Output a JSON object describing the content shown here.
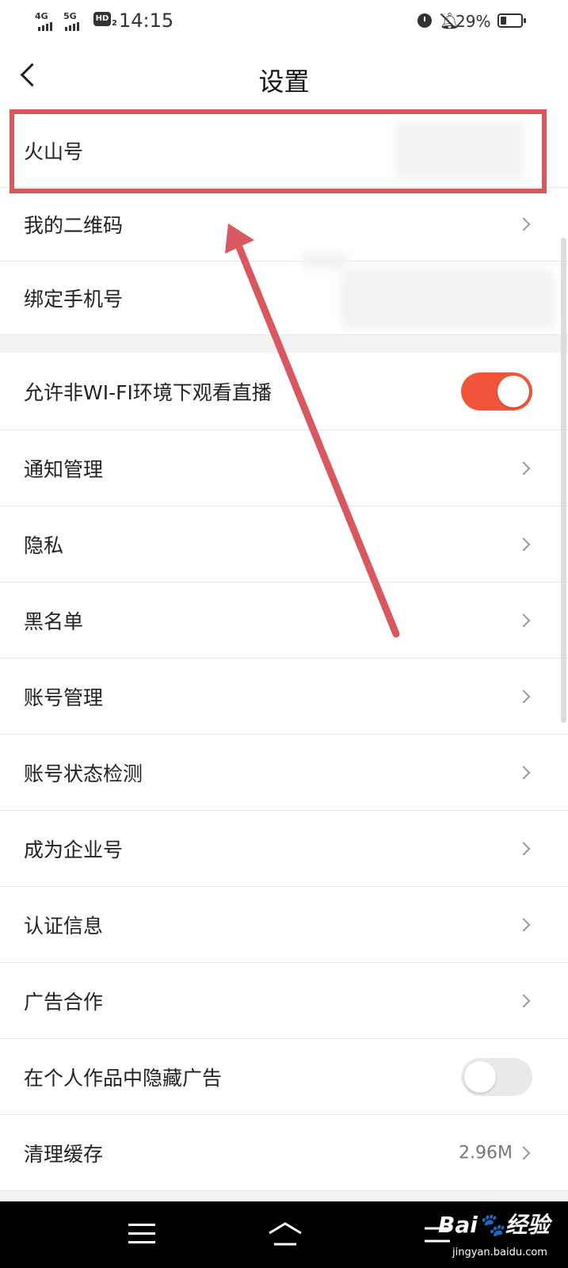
{
  "status_bar": {
    "net1": "4G",
    "net2": "5G",
    "hd": "HD",
    "hd_sub": "2",
    "time": "14:15",
    "battery_pct": "29%",
    "battery_level": 0.29,
    "icons": [
      "signal-icon",
      "alarm-icon",
      "bell-off-icon",
      "battery-icon"
    ]
  },
  "header": {
    "title": "设置",
    "back_icon": "back-arrow-icon"
  },
  "account_rows": [
    {
      "label": "火山号"
    },
    {
      "label": "我的二维码"
    },
    {
      "label": "绑定手机号"
    }
  ],
  "settings_rows": [
    {
      "label": "允许非WI-FI环境下观看直播",
      "control": "toggle",
      "state": "on"
    },
    {
      "label": "通知管理"
    },
    {
      "label": "隐私"
    },
    {
      "label": "黑名单"
    },
    {
      "label": "账号管理"
    },
    {
      "label": "账号状态检测"
    },
    {
      "label": "成为企业号"
    },
    {
      "label": "认证信息"
    },
    {
      "label": "广告合作"
    },
    {
      "label": "在个人作品中隐藏广告",
      "control": "toggle",
      "state": "off"
    },
    {
      "label": "清理缓存",
      "value": "2.96M"
    }
  ],
  "annotation": {
    "box_color": "#d9575f",
    "arrow_color": "#d9575f"
  },
  "colors": {
    "toggle_on": "#f4553a",
    "toggle_off": "#e9e9e9"
  },
  "watermark": {
    "brand": "Bai",
    "brand2": "经验",
    "url": "jingyan.baidu.com"
  }
}
